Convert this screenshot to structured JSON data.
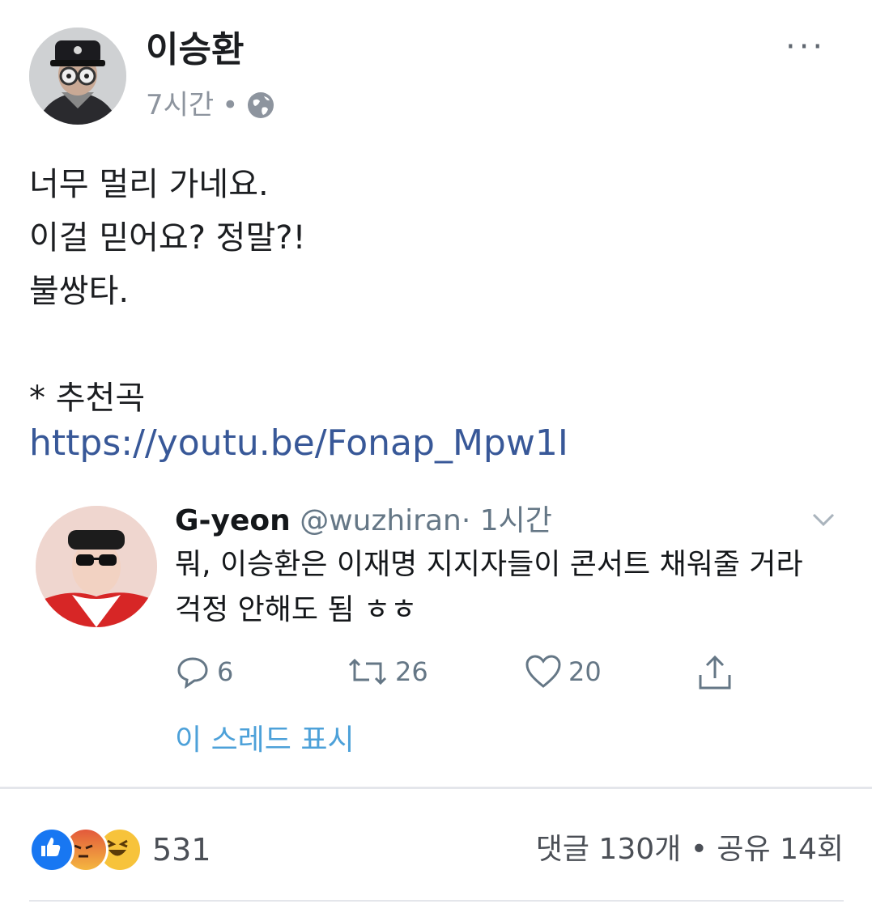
{
  "post": {
    "author": "이승환",
    "time": "7시간",
    "separator": "•",
    "audience_icon": "globe-icon",
    "more_label": "···",
    "lines": [
      "너무 멀리 가네요.",
      "이걸 믿어요? 정말?!",
      "불쌍타.",
      "",
      "* 추천곡"
    ],
    "link": "https://youtu.be/Fonap_Mpw1I"
  },
  "tweet": {
    "name": "G-yeon",
    "handle": "@wuzhiran",
    "time": "· 1시간",
    "text": "뭐, 이승환은 이재명 지지자들이 콘서트 채워줄 거라 걱정 안해도 됨 ㅎㅎ",
    "replies": "6",
    "retweets": "26",
    "likes": "20",
    "show_thread": "이 스레드 표시"
  },
  "footer": {
    "reaction_count": "531",
    "reactions": [
      "like-icon",
      "angry-icon",
      "haha-icon"
    ],
    "stats": "댓글 130개 • 공유 14회"
  },
  "colors": {
    "link": "#385898",
    "muted": "#8d949e",
    "tweet_blue": "#4da1d9",
    "fb_blue": "#1877f2"
  }
}
